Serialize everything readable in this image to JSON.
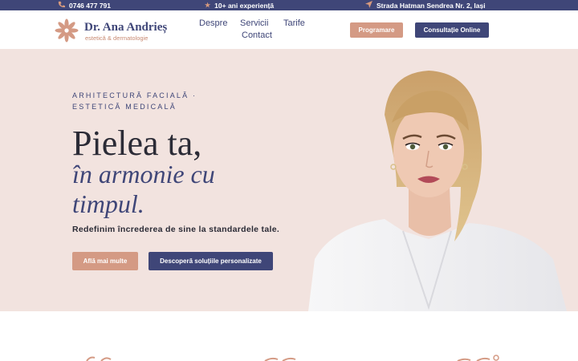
{
  "topbar": {
    "phone": "0746 477 791",
    "phone_icon": "phone-icon",
    "experience": "10+ ani experiență",
    "experience_icon": "star-icon",
    "address": "Strada Hatman Sendrea Nr. 2, Iași",
    "address_icon": "location-arrow-icon"
  },
  "logo": {
    "name": "Dr. Ana Andrieș",
    "subtitle": "estetică & dermatologie",
    "mark_icon": "flower-icon"
  },
  "nav": {
    "items": [
      "Despre",
      "Servicii",
      "Tarife",
      "Contact"
    ]
  },
  "header_buttons": {
    "programare": "Programare",
    "consultatie": "Consultație Online"
  },
  "hero": {
    "eyebrow": "ARHITECTURĂ FACIALĂ · ESTETICĂ MEDICALĂ",
    "title": "Pielea ta,",
    "title_italic": "în armonie cu timpul.",
    "lead": "Redefinim încrederea de sine la standardele tale.",
    "btn_primary": "Află mai multe",
    "btn_secondary": "Descoperă soluțiile personalizate"
  },
  "colors": {
    "navy": "#3f4678",
    "rose": "#d49a84",
    "hero_bg": "#f2e3df"
  }
}
